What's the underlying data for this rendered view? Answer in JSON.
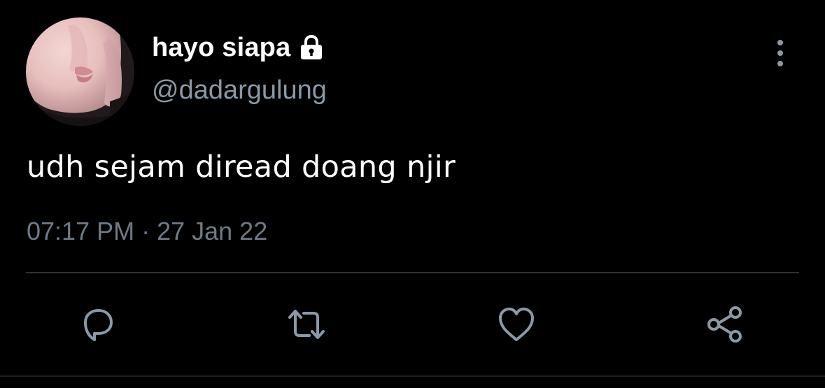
{
  "author": {
    "display_name": "hayo siapa",
    "handle": "@dadargulung",
    "protected_icon": "lock-icon",
    "avatar": "profile-photo"
  },
  "tweet": {
    "text": "udh sejam diread doang njir",
    "time": "07:17 PM",
    "separator": "·",
    "date": "27 Jan 22"
  },
  "actions": {
    "reply_icon": "reply-icon",
    "retweet_icon": "retweet-icon",
    "like_icon": "heart-icon",
    "share_icon": "share-icon",
    "more_icon": "more-vertical-icon"
  },
  "colors": {
    "background": "#000000",
    "primary_text": "#ffffff",
    "secondary_text": "#8b98a5",
    "icon_gray": "#8b98a5",
    "divider": "#2f3336"
  }
}
